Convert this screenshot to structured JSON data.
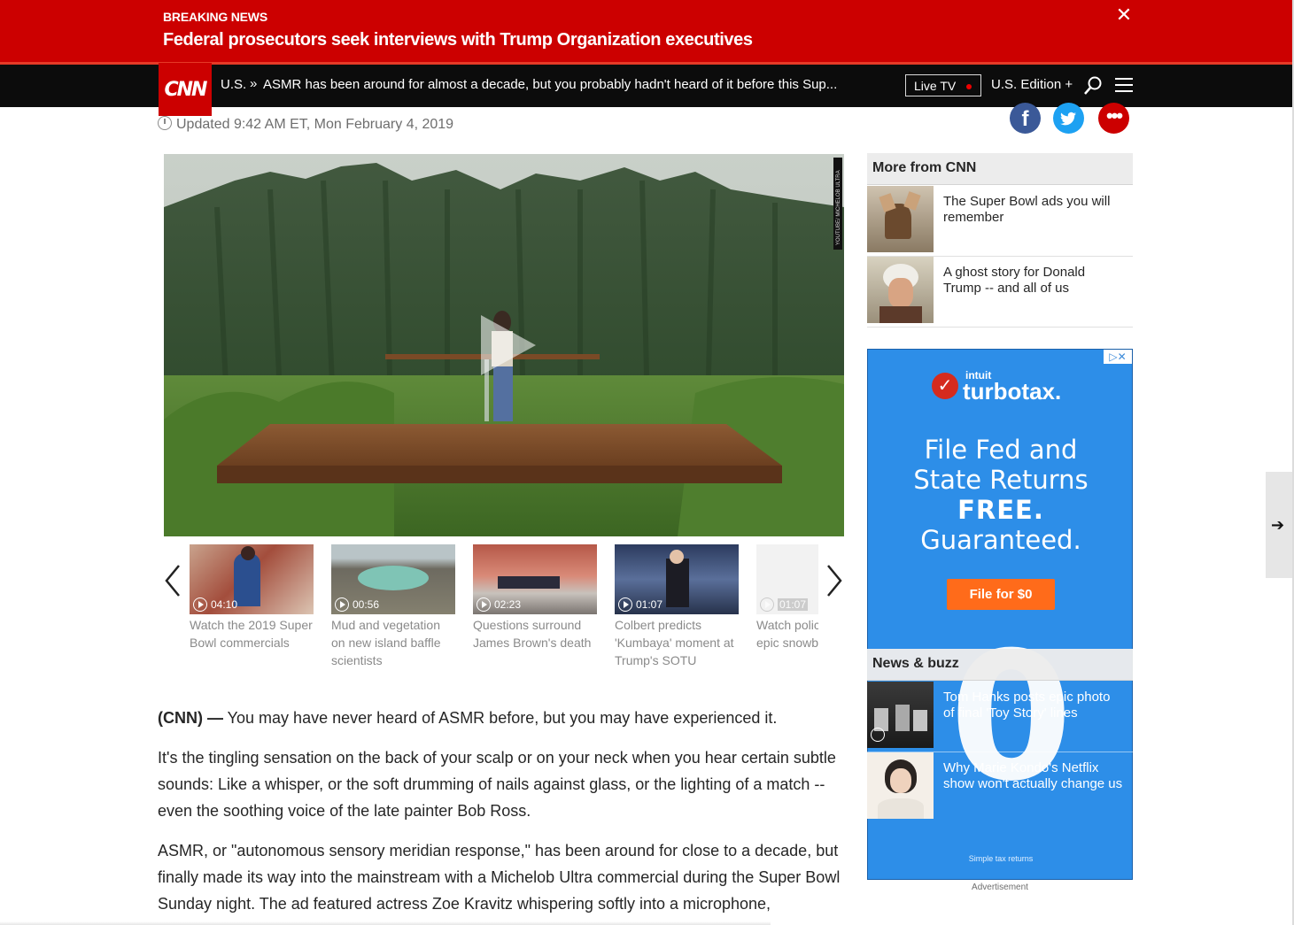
{
  "breaking": {
    "kicker": "BREAKING NEWS",
    "headline": "Federal prosecutors seek interviews with Trump Organization executives",
    "close_symbol": "✕"
  },
  "nav": {
    "logo": "CNN",
    "section": "U.S.",
    "separator": "»",
    "article_title": "ASMR has been around for almost a decade, but you probably hadn't heard of it before this Sup...",
    "live_tv": "Live TV",
    "edition": "U.S. Edition +"
  },
  "article": {
    "updated": "Updated 9:42 AM ET, Mon February 4, 2019",
    "video_credit": "YOUTUBE/ MICHELOB ULTRA",
    "dateline": "(CNN) —",
    "paragraphs": [
      " You may have never heard of ASMR before, but you may have experienced it.",
      "It's the tingling sensation on the back of your scalp or on your neck when you hear certain subtle sounds: Like a whisper, or the soft drumming of nails against glass, or the lighting of a match -- even the soothing voice of the late painter Bob Ross.",
      "ASMR, or \"autonomous sensory meridian response,\" has been around for close to a decade, but finally made its way into the mainstream with a Michelob Ultra commercial during the Super Bowl Sunday night. The ad featured actress Zoe Kravitz whispering softly into a microphone,"
    ]
  },
  "carousel": {
    "items": [
      {
        "duration": "04:10",
        "caption": "Watch the 2019 Super Bowl commercials"
      },
      {
        "duration": "00:56",
        "caption": "Mud and vegetation on new island baffle scientists"
      },
      {
        "duration": "02:23",
        "caption": "Questions surround James Brown's death"
      },
      {
        "duration": "01:07",
        "caption": "Colbert predicts 'Kumbaya' moment at Trump's SOTU"
      },
      {
        "duration": "01:07",
        "caption": "Watch police have epic snowball fight"
      }
    ]
  },
  "rail": {
    "more_title": "More from CNN",
    "more_items": [
      {
        "title": "The Super Bowl ads you will remember"
      },
      {
        "title": "A ghost story for Donald Trump -- and all of us"
      }
    ],
    "news_title": "News & buzz",
    "news_items": [
      {
        "title": "Tom Hanks posts epic photo of final 'Toy Story' lines"
      },
      {
        "title": "Why Marie Kondo's Netflix show won't actually change us"
      }
    ]
  },
  "ad": {
    "adchoice": "▷✕",
    "intuit": "intuit",
    "brand": "turbotax.",
    "line1": "File Fed and",
    "line2": "State Returns",
    "line3": "FREE.",
    "line4": "Guaranteed.",
    "cta": "File for $0",
    "big": "0",
    "tagline": "Simple tax returns",
    "label": "Advertisement"
  },
  "colors": {
    "cnn_red": "#cc0000",
    "nav_black": "#0c0c0c",
    "ad_blue": "#2d8ee8",
    "facebook": "#3b5998",
    "twitter": "#1da1f2"
  },
  "icons": {
    "close": "close-icon",
    "search": "search-icon",
    "menu": "hamburger-menu-icon",
    "clock": "clock-icon",
    "play": "play-icon",
    "prev": "chevron-left-icon",
    "next": "chevron-right-icon",
    "arrow": "arrow-right-icon"
  }
}
